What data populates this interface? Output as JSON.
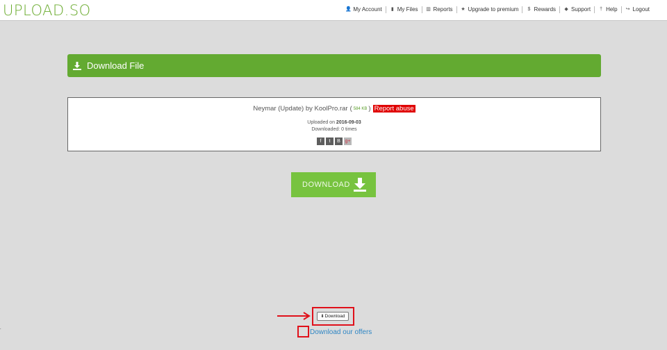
{
  "logo": "UPLOAD.SO",
  "nav": [
    {
      "icon": "user-icon",
      "glyph": "👤",
      "label": "My Account"
    },
    {
      "icon": "file-icon",
      "glyph": "▮",
      "label": "My Files"
    },
    {
      "icon": "bar-chart-icon",
      "glyph": "▥",
      "label": "Reports"
    },
    {
      "icon": "star-icon",
      "glyph": "★",
      "label": "Upgrade to premium"
    },
    {
      "icon": "dollar-icon",
      "glyph": "$",
      "label": "Rewards"
    },
    {
      "icon": "pen-icon",
      "glyph": "◆",
      "label": "Support"
    },
    {
      "icon": "help-icon",
      "glyph": "†",
      "label": "Help"
    },
    {
      "icon": "logout-icon",
      "glyph": "↪",
      "label": "Logout"
    }
  ],
  "header": {
    "title": "Download File"
  },
  "file": {
    "name": "Neymar (Update) by KoolPro.rar",
    "open_paren": "(",
    "size": "584 KB",
    "close_paren": ")",
    "report_label": "Report abuse",
    "uploaded_label": "Uploaded on",
    "uploaded_date": "2016-09-03",
    "downloaded_text": "Downloaded: 0 times",
    "social": [
      {
        "icon": "facebook-icon",
        "glyph": "f"
      },
      {
        "icon": "twitter-icon",
        "glyph": "t"
      },
      {
        "icon": "vk-icon",
        "glyph": "B"
      },
      {
        "icon": "google-plus-icon",
        "glyph": "g+"
      }
    ]
  },
  "download_button": {
    "label": "DOWNLOAD"
  },
  "small_download": {
    "label": "Download"
  },
  "offers_link": "Download our offers",
  "colors": {
    "brand": "#63aa31",
    "download": "#77c33f",
    "highlight": "#e0101a",
    "link": "#2f86c4"
  }
}
